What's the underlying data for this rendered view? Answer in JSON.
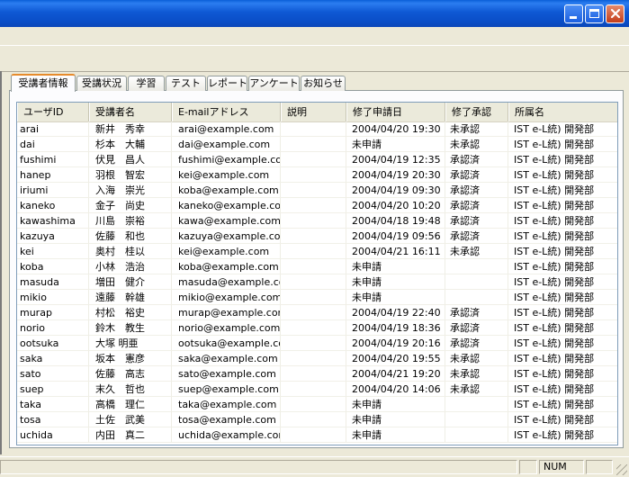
{
  "tabs": [
    {
      "label": "受講者情報",
      "active": true
    },
    {
      "label": "受講状況",
      "active": false
    },
    {
      "label": "学習",
      "active": false
    },
    {
      "label": "テスト",
      "active": false
    },
    {
      "label": "レポート",
      "active": false
    },
    {
      "label": "アンケート",
      "active": false
    },
    {
      "label": "お知らせ",
      "active": false
    }
  ],
  "grid": {
    "columns": [
      "ユーザID",
      "受講者名",
      "E-mailアドレス",
      "説明",
      "修了申請日",
      "修了承認",
      "所属名"
    ],
    "rows": [
      [
        "arai",
        "新井　秀幸",
        "arai@example.com",
        "",
        "2004/04/20 19:30",
        "未承認",
        "IST e-L統) 開発部"
      ],
      [
        "dai",
        "杉本　大輔",
        "dai@example.com",
        "",
        "未申請",
        "未承認",
        "IST e-L統) 開発部"
      ],
      [
        "fushimi",
        "伏見　昌人",
        "fushimi@example.com",
        "",
        "2004/04/19 12:35",
        "承認済",
        "IST e-L統) 開発部"
      ],
      [
        "hanep",
        "羽根　智宏",
        "kei@example.com",
        "",
        "2004/04/19 20:30",
        "承認済",
        "IST e-L統) 開発部"
      ],
      [
        "iriumi",
        "入海　崇光",
        "koba@example.com",
        "",
        "2004/04/19 09:30",
        "承認済",
        "IST e-L統) 開発部"
      ],
      [
        "kaneko",
        "金子　尚史",
        "kaneko@example.com",
        "",
        "2004/04/20 10:20",
        "承認済",
        "IST e-L統) 開発部"
      ],
      [
        "kawashima",
        "川島　崇裕",
        "kawa@example.com",
        "",
        "2004/04/18 19:48",
        "承認済",
        "IST e-L統) 開発部"
      ],
      [
        "kazuya",
        "佐藤　和也",
        "kazuya@example.com",
        "",
        "2004/04/19 09:56",
        "承認済",
        "IST e-L統) 開発部"
      ],
      [
        "kei",
        "奥村　桂以",
        "kei@example.com",
        "",
        "2004/04/21 16:11",
        "未承認",
        "IST e-L統) 開発部"
      ],
      [
        "koba",
        "小林　浩治",
        "koba@example.com",
        "",
        "未申請",
        "",
        "IST e-L統) 開発部"
      ],
      [
        "masuda",
        "増田　健介",
        "masuda@example.com",
        "",
        "未申請",
        "",
        "IST e-L統) 開発部"
      ],
      [
        "mikio",
        "遠藤　幹雄",
        "mikio@example.com",
        "",
        "未申請",
        "",
        "IST e-L統) 開発部"
      ],
      [
        "murap",
        "村松　裕史",
        "murap@example.com",
        "",
        "2004/04/19 22:40",
        "承認済",
        "IST e-L統) 開発部"
      ],
      [
        "norio",
        "鈴木　教生",
        "norio@example.com",
        "",
        "2004/04/19 18:36",
        "承認済",
        "IST e-L統) 開発部"
      ],
      [
        "ootsuka",
        "大塚 明亜",
        "ootsuka@example.com",
        "",
        "2004/04/19 20:16",
        "承認済",
        "IST e-L統) 開発部"
      ],
      [
        "saka",
        "坂本　憲彦",
        "saka@example.com",
        "",
        "2004/04/20 19:55",
        "未承認",
        "IST e-L統) 開発部"
      ],
      [
        "sato",
        "佐藤　高志",
        "sato@example.com",
        "",
        "2004/04/21 19:20",
        "未承認",
        "IST e-L統) 開発部"
      ],
      [
        "suep",
        "末久　哲也",
        "suep@example.com",
        "",
        "2004/04/20 14:06",
        "未承認",
        "IST e-L統) 開発部"
      ],
      [
        "taka",
        "高橋　理仁",
        "taka@example.com",
        "",
        "未申請",
        "",
        "IST e-L統) 開発部"
      ],
      [
        "tosa",
        "土佐　武美",
        "tosa@example.com",
        "",
        "未申請",
        "",
        "IST e-L統) 開発部"
      ],
      [
        "uchida",
        "内田　真二",
        "uchida@example.com",
        "",
        "未申請",
        "",
        "IST e-L統) 開発部"
      ]
    ]
  },
  "status": {
    "num": "NUM"
  },
  "icons": {
    "minimize": "minimize-icon",
    "maximize": "maximize-icon",
    "close": "close-icon"
  },
  "colors": {
    "titlebar": "#0a4ec7",
    "active_tab_accent": "#e68b2c",
    "grid_border": "#7f9db9"
  }
}
